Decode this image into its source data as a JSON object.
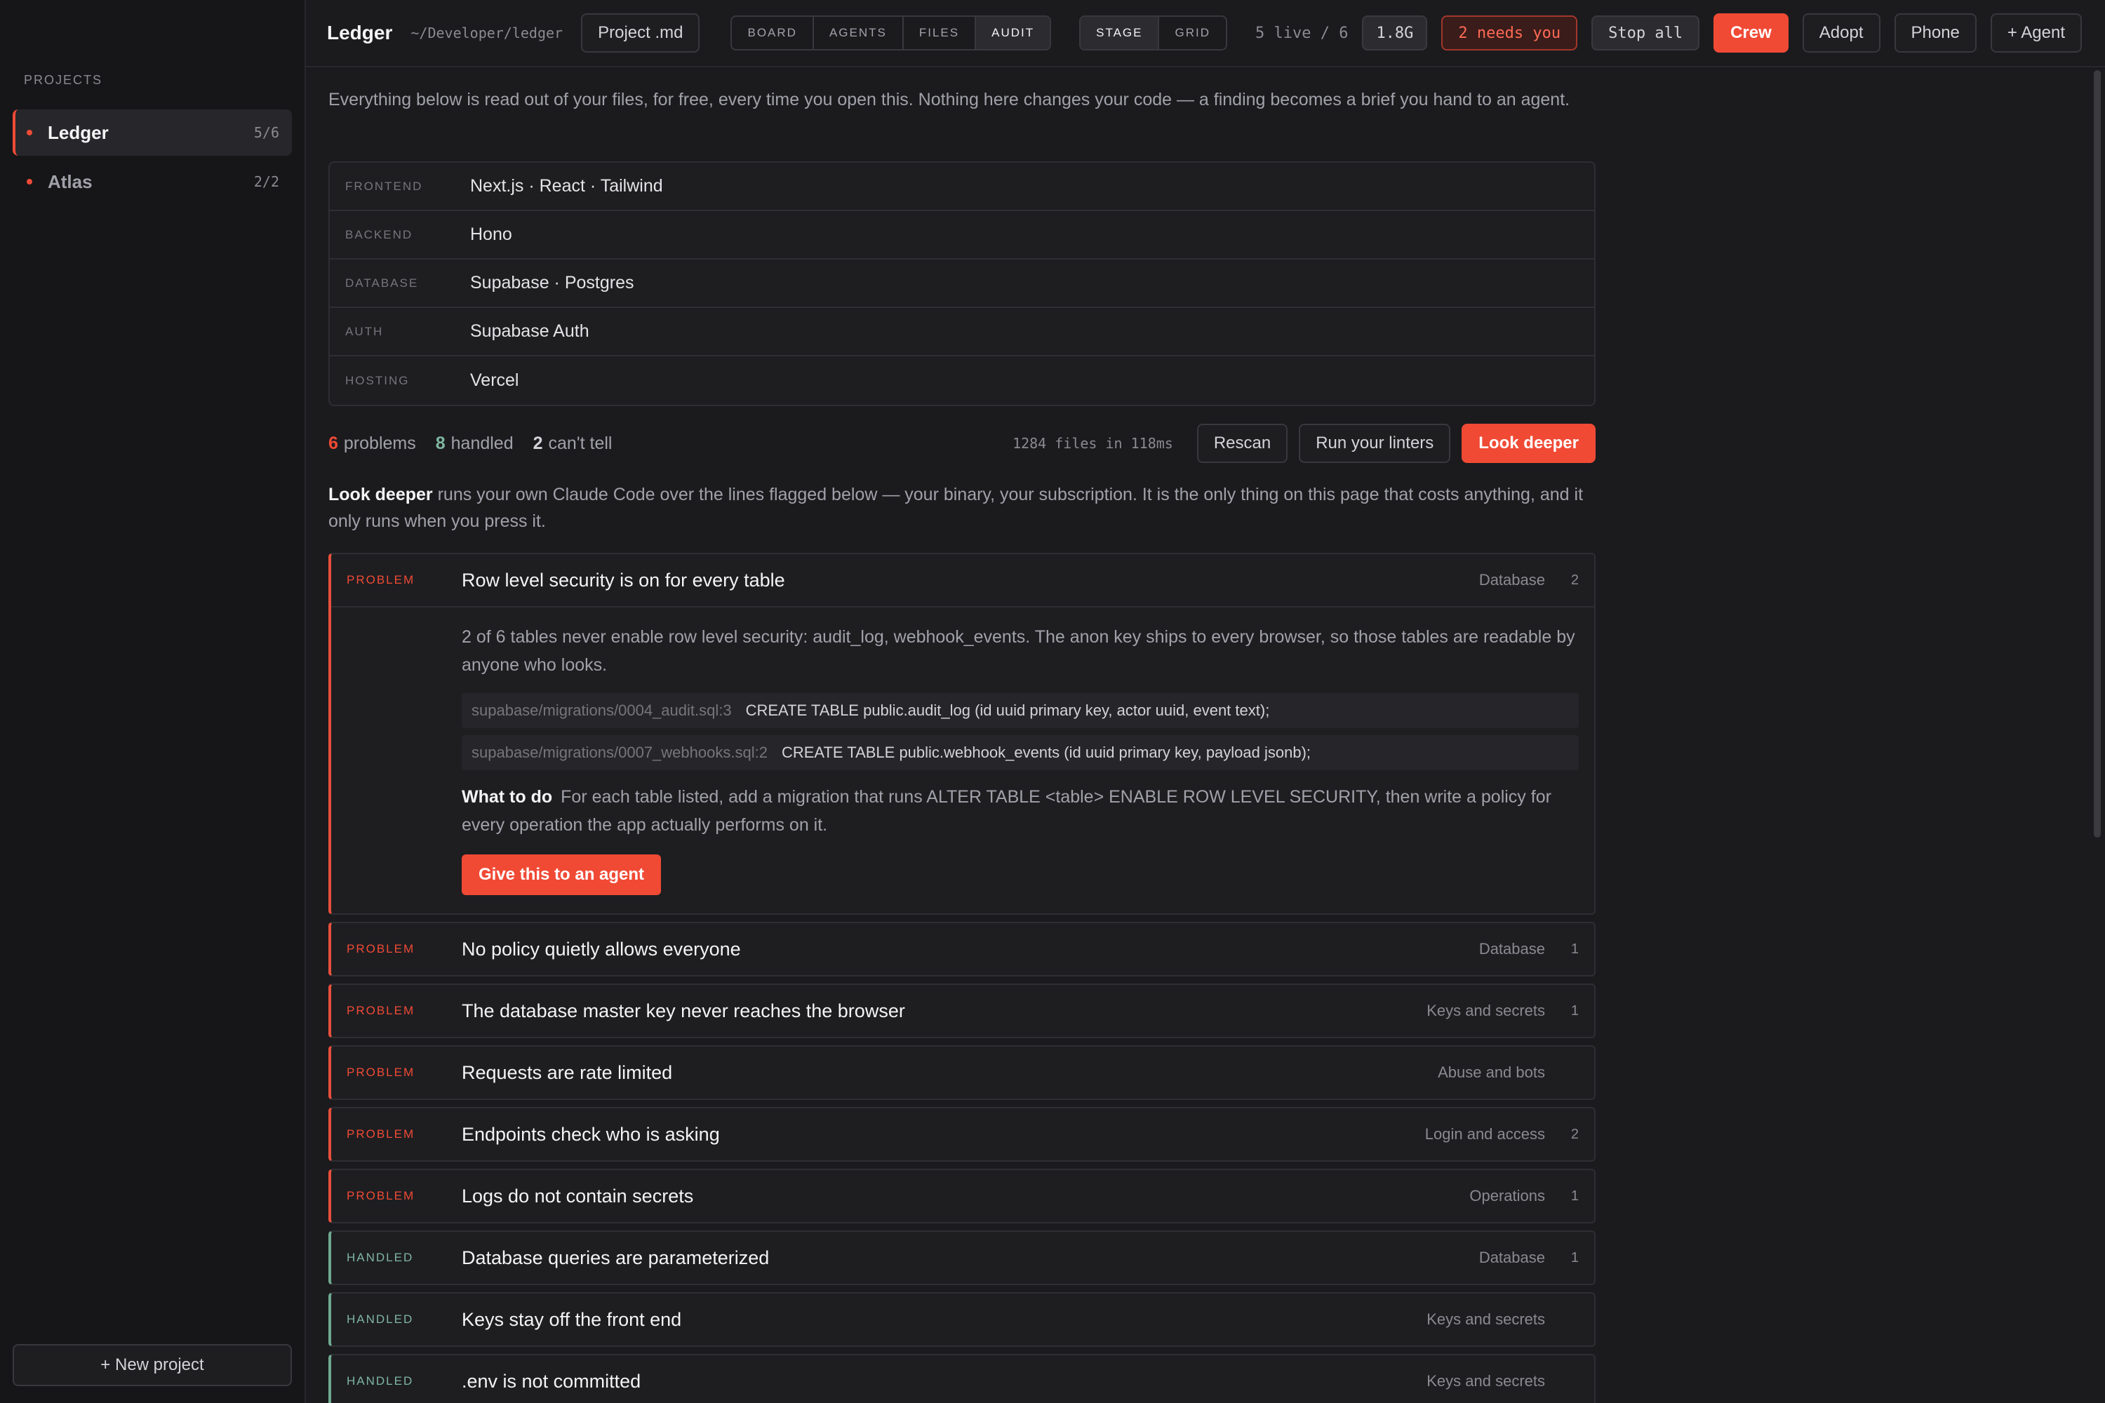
{
  "sidebar": {
    "heading": "PROJECTS",
    "projects": [
      {
        "name": "Ledger",
        "count": "5/6"
      },
      {
        "name": "Atlas",
        "count": "2/2"
      }
    ],
    "new_project": "+ New project"
  },
  "topbar": {
    "title": "Ledger",
    "path": "~/Developer/ledger",
    "project_md": "Project .md",
    "views": [
      "BOARD",
      "AGENTS",
      "FILES",
      "AUDIT"
    ],
    "active_view": "AUDIT",
    "layouts": [
      "STAGE",
      "GRID"
    ],
    "active_layout": "STAGE",
    "live": "5 live / 6",
    "memory": "1.8G",
    "needs_you": "2 needs you",
    "stop_all": "Stop all",
    "crew": "Crew",
    "adopt": "Adopt",
    "phone": "Phone",
    "add_agent": "+ Agent"
  },
  "intro": "Everything below is read out of your files, for free, every time you open this. Nothing here changes your code — a finding becomes a brief you hand to an agent.",
  "stack": [
    {
      "key": "FRONTEND",
      "value": "Next.js · React · Tailwind"
    },
    {
      "key": "BACKEND",
      "value": "Hono"
    },
    {
      "key": "DATABASE",
      "value": "Supabase · Postgres"
    },
    {
      "key": "AUTH",
      "value": "Supabase Auth"
    },
    {
      "key": "HOSTING",
      "value": "Vercel"
    }
  ],
  "summary": {
    "problems_count": "6",
    "problems_label": "problems",
    "handled_count": "8",
    "handled_label": "handled",
    "canttell_count": "2",
    "canttell_label": "can't tell",
    "files": "1284 files in 118ms",
    "rescan": "Rescan",
    "run_linters": "Run your linters",
    "look_deeper": "Look deeper"
  },
  "deeper_note": {
    "lead": "Look deeper",
    "text": " runs your own Claude Code over the lines flagged below — your binary, your subscription. It is the only thing on this page that costs anything, and it only runs when you press it."
  },
  "expanded_finding": {
    "status": "PROBLEM",
    "title": "Row level security is on for every table",
    "category": "Database",
    "count": "2",
    "description": "2 of 6 tables never enable row level security: audit_log, webhook_events. The anon key ships to every browser, so those tables are readable by anyone who looks.",
    "code": [
      {
        "path": "supabase/migrations/0004_audit.sql:3",
        "text": "CREATE TABLE public.audit_log (id uuid primary key, actor uuid, event text);"
      },
      {
        "path": "supabase/migrations/0007_webhooks.sql:2",
        "text": "CREATE TABLE public.webhook_events (id uuid primary key, payload jsonb);"
      }
    ],
    "todo_label": "What to do",
    "todo_text": "For each table listed, add a migration that runs ALTER TABLE <table> ENABLE ROW LEVEL SECURITY, then write a policy for every operation the app actually performs on it.",
    "action": "Give this to an agent"
  },
  "findings": [
    {
      "status": "PROBLEM",
      "kind": "problem",
      "title": "No policy quietly allows everyone",
      "category": "Database",
      "count": "1"
    },
    {
      "status": "PROBLEM",
      "kind": "problem",
      "title": "The database master key never reaches the browser",
      "category": "Keys and secrets",
      "count": "1"
    },
    {
      "status": "PROBLEM",
      "kind": "problem",
      "title": "Requests are rate limited",
      "category": "Abuse and bots",
      "count": ""
    },
    {
      "status": "PROBLEM",
      "kind": "problem",
      "title": "Endpoints check who is asking",
      "category": "Login and access",
      "count": "2"
    },
    {
      "status": "PROBLEM",
      "kind": "problem",
      "title": "Logs do not contain secrets",
      "category": "Operations",
      "count": "1"
    },
    {
      "status": "HANDLED",
      "kind": "handled",
      "title": "Database queries are parameterized",
      "category": "Database",
      "count": "1"
    },
    {
      "status": "HANDLED",
      "kind": "handled",
      "title": "Keys stay off the front end",
      "category": "Keys and secrets",
      "count": ""
    },
    {
      "status": "HANDLED",
      "kind": "handled",
      "title": ".env is not committed",
      "category": "Keys and secrets",
      "count": ""
    }
  ],
  "colors": {
    "accent": "#f04a35",
    "handled": "#7fb6a0",
    "background": "#1b1b1e",
    "sidebar": "#161618"
  }
}
